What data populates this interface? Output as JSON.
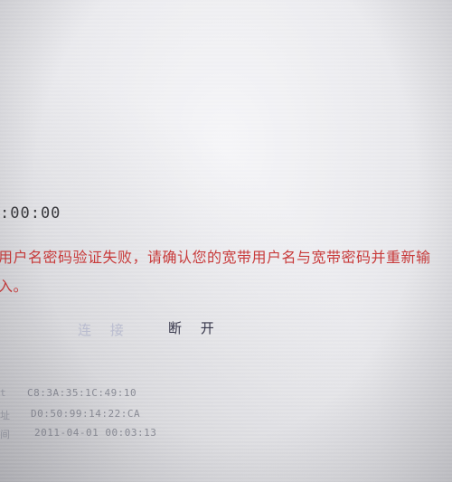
{
  "connection": {
    "duration": ":00:00",
    "error_message": "用户名密码验证失败，请确认您的宽带用户名与宽带密码并重新输入。",
    "connect_label": "连 接",
    "disconnect_label": "断 开"
  },
  "details": {
    "rows": [
      {
        "label": "t",
        "value": "C8:3A:35:1C:49:10"
      },
      {
        "label": "址",
        "value": "D0:50:99:14:22:CA"
      },
      {
        "label": "间",
        "value": "2011-04-01 00:03:13"
      }
    ]
  },
  "colors": {
    "error": "#c83a3a",
    "text": "#36364a",
    "disabled": "#b9bccf",
    "muted": "#8a8c96"
  }
}
